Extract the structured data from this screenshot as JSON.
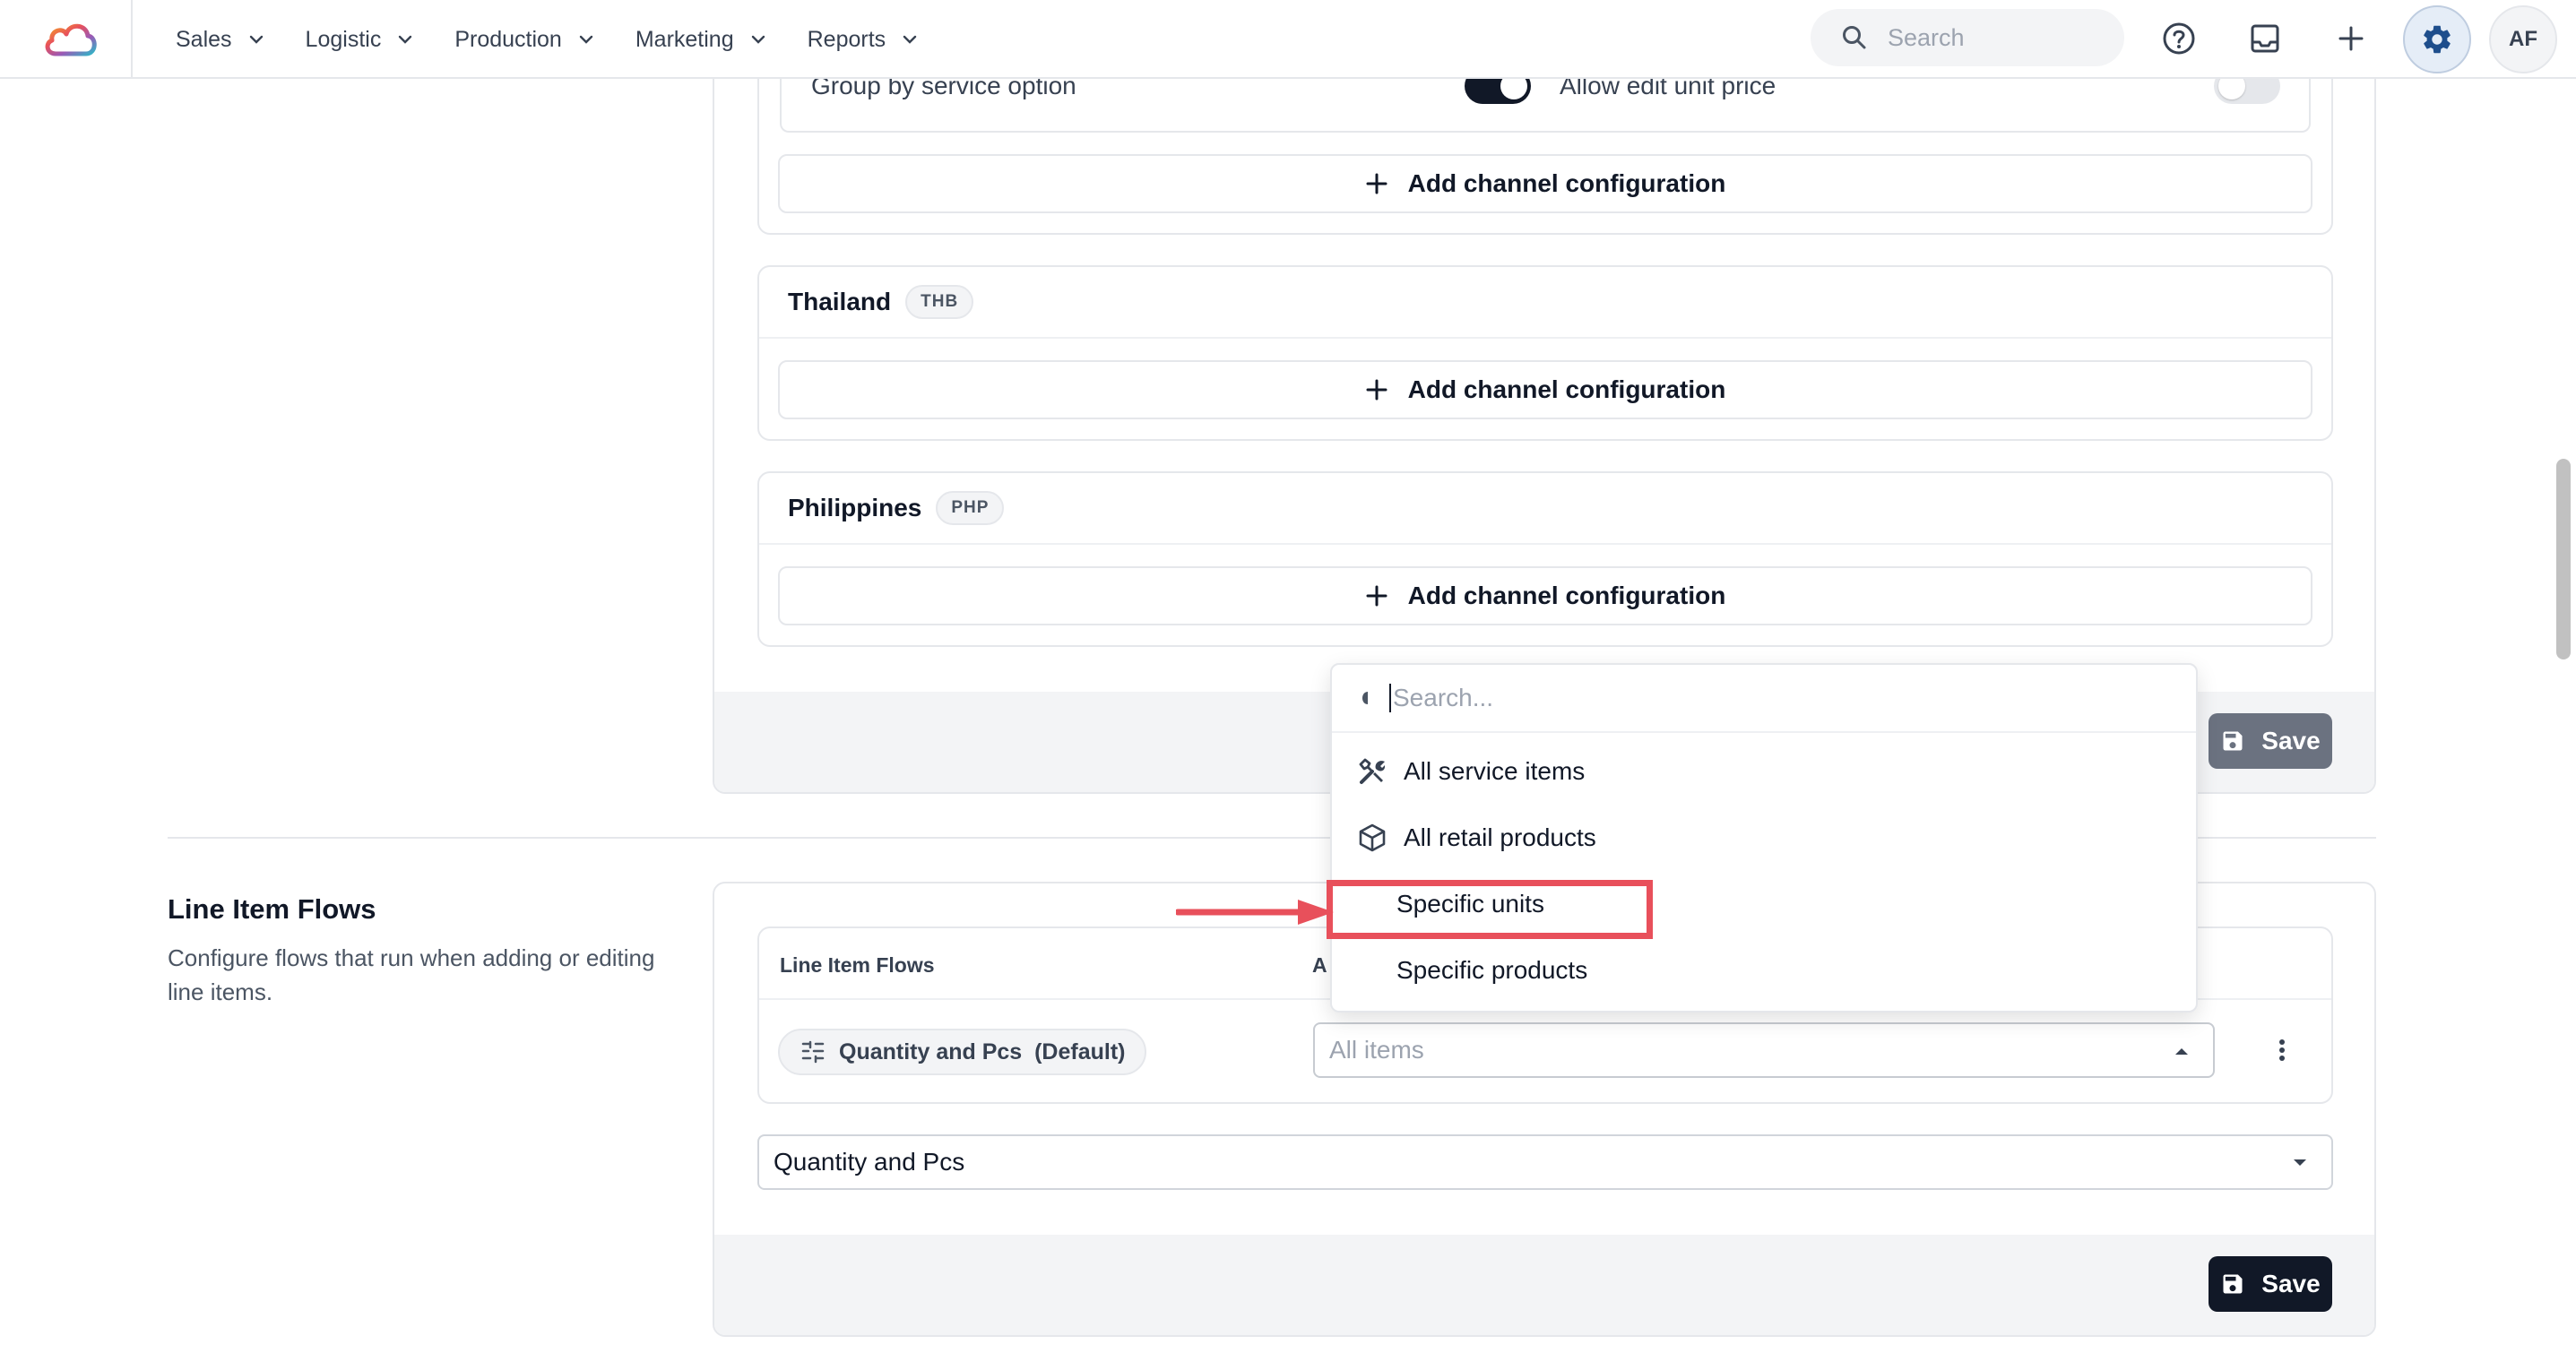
{
  "nav": {
    "items": [
      {
        "label": "Sales"
      },
      {
        "label": "Logistic"
      },
      {
        "label": "Production"
      },
      {
        "label": "Marketing"
      },
      {
        "label": "Reports"
      }
    ],
    "search_placeholder": "Search",
    "avatar_initials": "AF"
  },
  "channel_settings": {
    "group_by_label": "Group by service option",
    "allow_edit_label": "Allow edit unit price",
    "group_by_enabled": true,
    "allow_edit_enabled": false,
    "add_channel_label": "Add channel configuration",
    "countries": [
      {
        "name": "Thailand",
        "currency": "THB"
      },
      {
        "name": "Philippines",
        "currency": "PHP"
      }
    ],
    "save_label": "Save"
  },
  "line_item_flows": {
    "title": "Line Item Flows",
    "description": "Configure flows that run when adding or editing line items.",
    "table": {
      "col_flows": "Line Item Flows",
      "col_applies_partial": "A"
    },
    "row": {
      "flow_name": "Quantity and Pcs  (Default)",
      "applies_to_placeholder": "All items"
    },
    "flow_select_value": "Quantity and Pcs",
    "save_label": "Save"
  },
  "dropdown": {
    "search_placeholder": "Search...",
    "options": [
      {
        "label": "All service items",
        "icon": "tools-icon"
      },
      {
        "label": "All retail products",
        "icon": "box-icon"
      },
      {
        "label": "Specific units",
        "icon": ""
      },
      {
        "label": "Specific products",
        "icon": ""
      }
    ],
    "highlighted_option": "Specific units"
  },
  "colors": {
    "toggle_on": "#111827",
    "toggle_off": "#e5e7eb",
    "save_disabled": "#6b7280",
    "save_active": "#111827",
    "annotation": "#e8505b",
    "gear_active": "#1e4e8c"
  }
}
